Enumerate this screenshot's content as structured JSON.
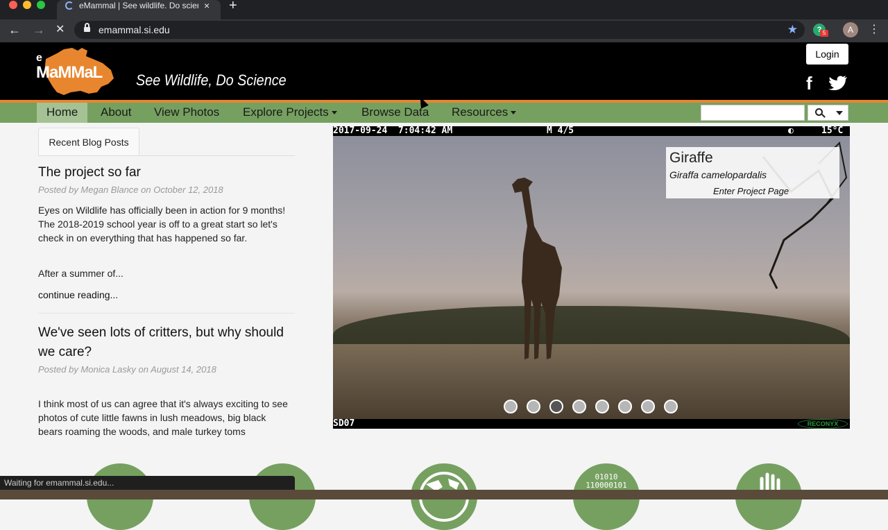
{
  "browser": {
    "tab_title": "eMammal | See wildlife. Do science.",
    "tab_close": "×",
    "new_tab": "+",
    "url": "emammal.si.edu",
    "back": "←",
    "forward": "→",
    "stop": "✕",
    "star": "★",
    "extension_badge": "5",
    "profile_initial": "A",
    "menu": "⋮",
    "status_text": "Waiting for emammal.si.edu..."
  },
  "header": {
    "logo_e": "e",
    "logo_word": "MaMMaL",
    "tagline": "See Wildlife, Do Science",
    "login_label": "Login",
    "facebook": "f"
  },
  "nav": {
    "items": [
      {
        "label": "Home",
        "active": true
      },
      {
        "label": "About"
      },
      {
        "label": "View Photos"
      },
      {
        "label": "Explore Projects",
        "dropdown": true
      },
      {
        "label": "Browse Data"
      },
      {
        "label": "Resources",
        "dropdown": true
      }
    ],
    "search_value": "",
    "search_placeholder": ""
  },
  "blog": {
    "tab_label": "Recent Blog Posts",
    "posts": [
      {
        "title": "The project so far",
        "meta": "Posted by Megan Blance on October 12, 2018",
        "body": "Eyes on Wildlife has officially been in action for 9 months! The 2018-2019 school year is off to a great start so let's check in on everything that has happened so far.",
        "excerpt_tail": "After a summer of...",
        "continue": "continue reading..."
      },
      {
        "title": "We've seen lots of critters, but why should we care?",
        "meta": "Posted by Monica Lasky on August 14, 2018",
        "body": "I think most of us can agree that it's always exciting to see photos of cute little fawns in lush meadows, big black bears roaming the woods, and male turkey toms"
      }
    ]
  },
  "slideshow": {
    "stamp_datetime": "2017-09-24  7:04:42 AM",
    "stamp_frame": "M 4/5",
    "stamp_moon": "◐",
    "stamp_temp": "15°C",
    "camera_id": "SD07",
    "camera_brand": "RECONYX",
    "species_name": "Giraffe",
    "species_latin": "Giraffa camelopardalis",
    "project_link": "Enter Project Page",
    "dot_count": 8,
    "active_dot": 3
  },
  "features": {
    "binary_text": "01010\n110000101"
  },
  "colors": {
    "nav_green": "#76a060",
    "accent_orange": "#e8862f"
  }
}
